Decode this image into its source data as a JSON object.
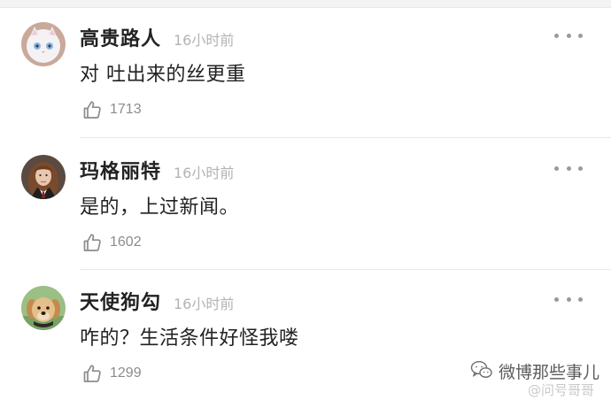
{
  "comments": [
    {
      "username": "高贵路人",
      "time": "16小时前",
      "text": "对 吐出来的丝更重",
      "likes": "1713",
      "avatar": "white-cat-avatar"
    },
    {
      "username": "玛格丽特",
      "time": "16小时前",
      "text": "是的，上过新闻。",
      "likes": "1602",
      "avatar": "girl-portrait-avatar"
    },
    {
      "username": "天使狗勾",
      "time": "16小时前",
      "text": "咋的？生活条件好怪我喽",
      "likes": "1299",
      "avatar": "puppy-avatar"
    }
  ],
  "watermark": {
    "main": "微博那些事儿",
    "sub": "@问号哥哥"
  },
  "colors": {
    "text": "#222222",
    "meta": "#b3b3b3",
    "icon": "#8c8c8c",
    "divider": "#e8e8e8"
  }
}
